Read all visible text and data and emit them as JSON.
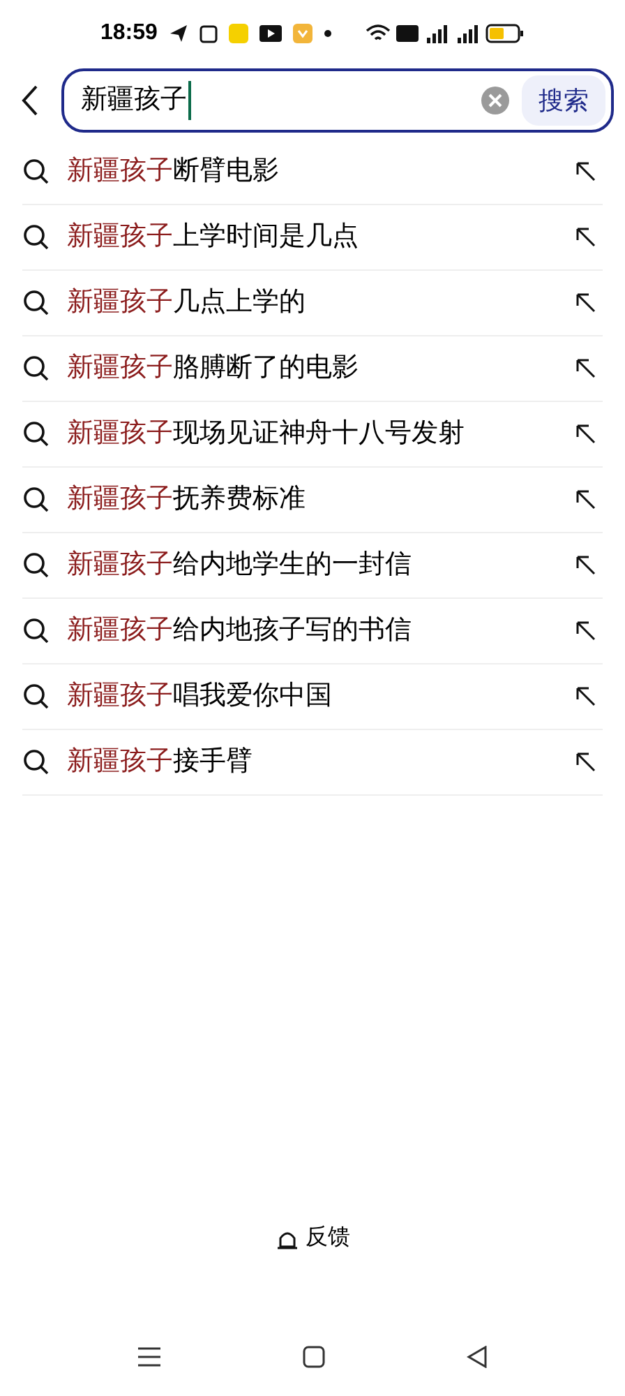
{
  "status_bar": {
    "time": "18:59"
  },
  "search": {
    "value": "新疆孩子",
    "button": "搜索"
  },
  "suggestions": [
    {
      "highlight": "新疆孩子",
      "rest": "断臂电影"
    },
    {
      "highlight": "新疆孩子",
      "rest": "上学时间是几点"
    },
    {
      "highlight": "新疆孩子",
      "rest": "几点上学的"
    },
    {
      "highlight": "新疆孩子",
      "rest": "胳膊断了的电影"
    },
    {
      "highlight": "新疆孩子",
      "rest": "现场见证神舟十八号发射"
    },
    {
      "highlight": "新疆孩子",
      "rest": "抚养费标准"
    },
    {
      "highlight": "新疆孩子",
      "rest": "给内地学生的一封信"
    },
    {
      "highlight": "新疆孩子",
      "rest": "给内地孩子写的书信"
    },
    {
      "highlight": "新疆孩子",
      "rest": "唱我爱你中国"
    },
    {
      "highlight": "新疆孩子",
      "rest": "接手臂"
    }
  ],
  "feedback": "反馈"
}
